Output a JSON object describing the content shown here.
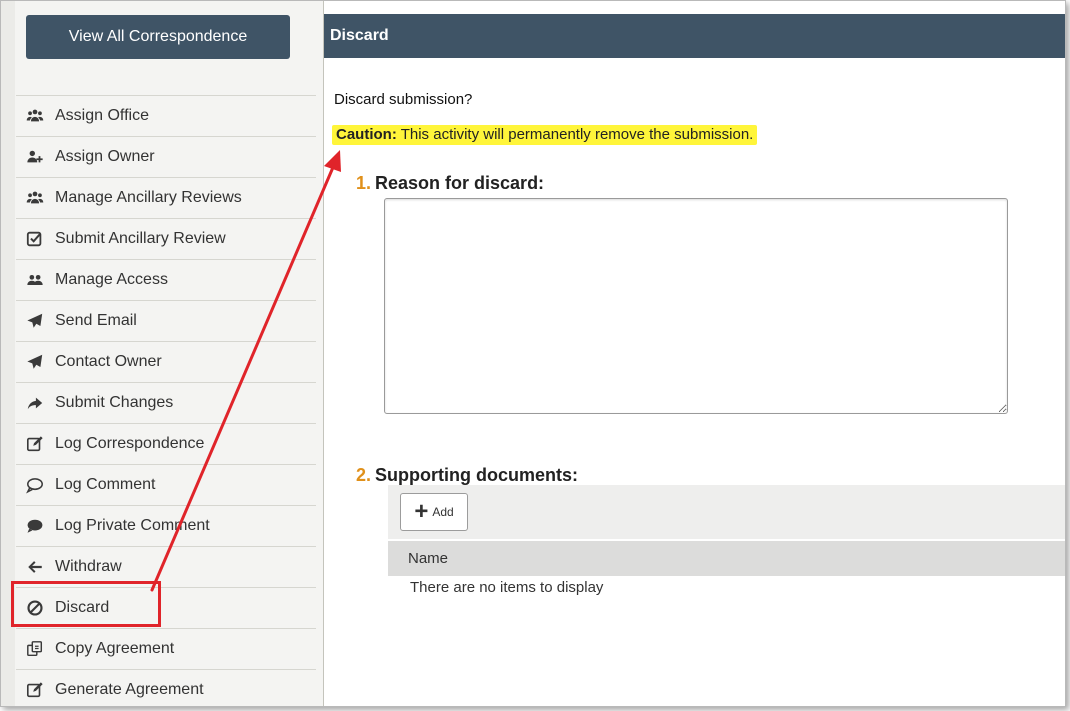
{
  "sidebar": {
    "view_all_label": "View All Correspondence",
    "items": [
      {
        "label": "Assign Office",
        "icon": "group-icon"
      },
      {
        "label": "Assign Owner",
        "icon": "user-plus-icon"
      },
      {
        "label": "Manage Ancillary Reviews",
        "icon": "group-icon"
      },
      {
        "label": "Submit Ancillary Review",
        "icon": "check-square-icon"
      },
      {
        "label": "Manage Access",
        "icon": "users-icon"
      },
      {
        "label": "Send Email",
        "icon": "paper-plane-icon"
      },
      {
        "label": "Contact Owner",
        "icon": "paper-plane-icon"
      },
      {
        "label": "Submit Changes",
        "icon": "share-arrow-icon"
      },
      {
        "label": "Log Correspondence",
        "icon": "edit-icon"
      },
      {
        "label": "Log Comment",
        "icon": "comment-outline-icon"
      },
      {
        "label": "Log Private Comment",
        "icon": "comment-filled-icon"
      },
      {
        "label": "Withdraw",
        "icon": "arrow-left-icon"
      },
      {
        "label": "Discard",
        "icon": "ban-icon"
      },
      {
        "label": "Copy Agreement",
        "icon": "copy-icon"
      },
      {
        "label": "Generate Agreement",
        "icon": "edit-icon"
      }
    ]
  },
  "dialog": {
    "title": "Discard",
    "confirm_text": "Discard submission?",
    "caution_label": "Caution:",
    "caution_text": " This activity will permanently remove the submission.",
    "section1": {
      "number": "1.",
      "title": "Reason for discard:"
    },
    "reason_value": "",
    "section2": {
      "number": "2.",
      "title": "Supporting documents:"
    },
    "add_label": "Add",
    "column_name": "Name",
    "empty_text": "There are no items to display"
  },
  "colors": {
    "header_bg": "#3f5466",
    "caution_highlight": "#fff53a",
    "section_number": "#e0901a",
    "annotation_red": "#e0242a"
  }
}
